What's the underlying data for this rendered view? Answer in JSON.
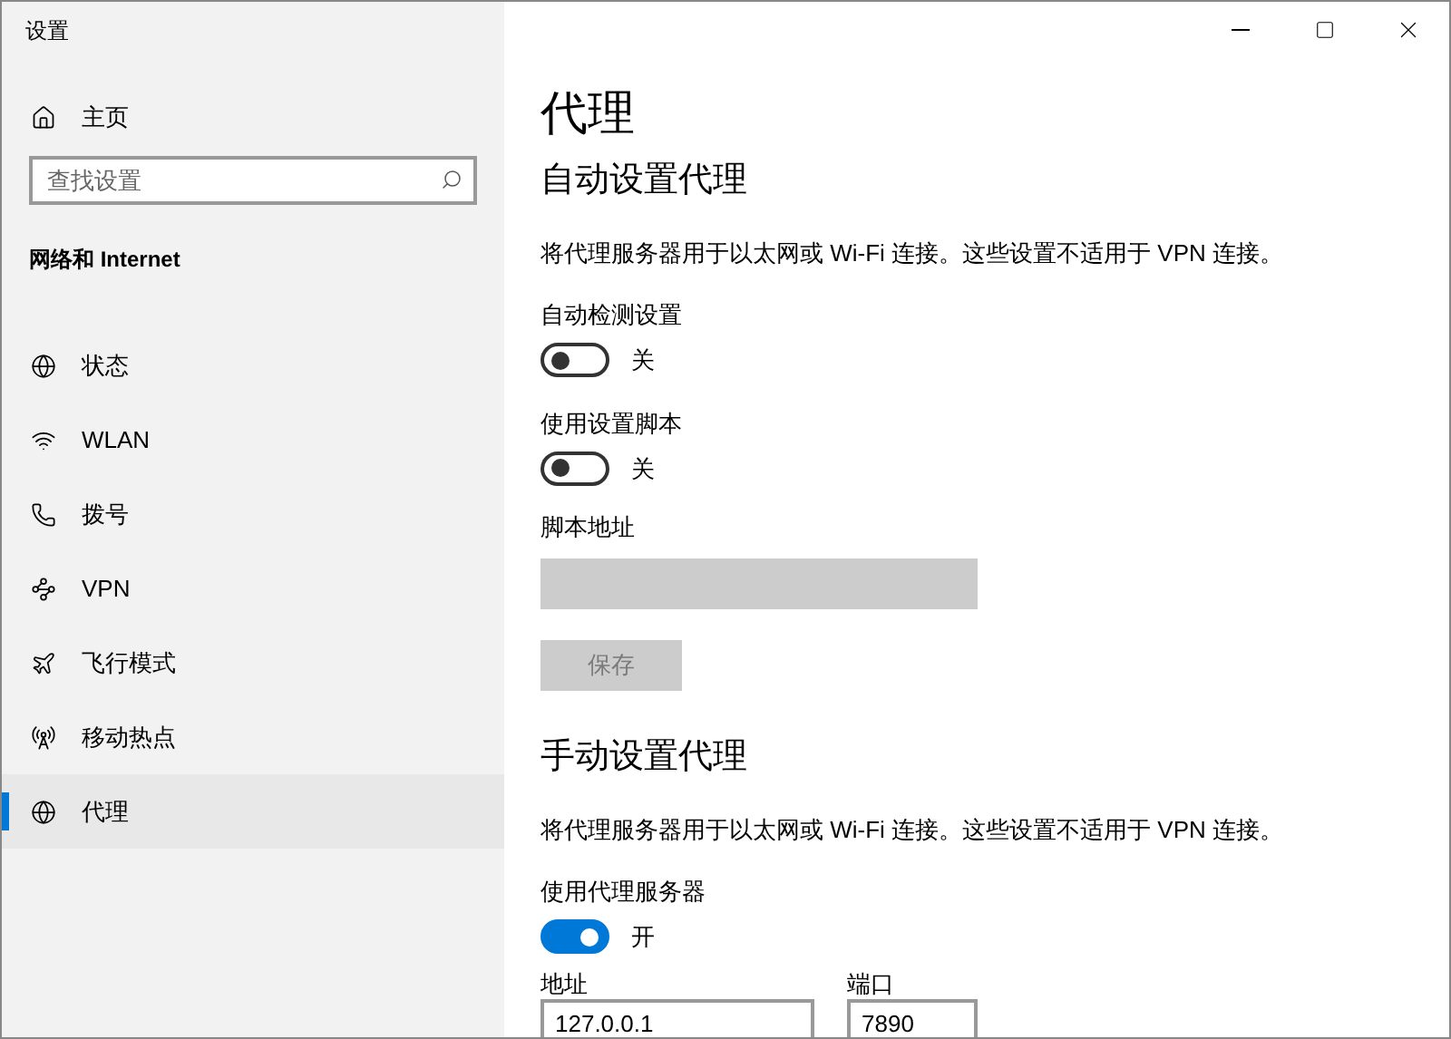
{
  "window": {
    "title": "设置"
  },
  "sidebar": {
    "home": {
      "label": "主页"
    },
    "search": {
      "placeholder": "查找设置"
    },
    "section_title": "网络和 Internet",
    "items": [
      {
        "label": "状态",
        "selected": false
      },
      {
        "label": "WLAN",
        "selected": false
      },
      {
        "label": "拨号",
        "selected": false
      },
      {
        "label": "VPN",
        "selected": false
      },
      {
        "label": "飞行模式",
        "selected": false
      },
      {
        "label": "移动热点",
        "selected": false
      },
      {
        "label": "代理",
        "selected": true
      }
    ]
  },
  "page": {
    "title": "代理",
    "sections": [
      {
        "heading": "自动设置代理",
        "description": "将代理服务器用于以太网或 Wi-Fi 连接。这些设置不适用于 VPN 连接。",
        "settings": [
          {
            "kind": "toggle",
            "label": "自动检测设置",
            "on": false,
            "state_text": "关"
          },
          {
            "kind": "toggle",
            "label": "使用设置脚本",
            "on": false,
            "state_text": "关"
          },
          {
            "kind": "field",
            "label": "脚本地址",
            "disabled": true
          },
          {
            "kind": "button",
            "label": "保存",
            "disabled": true
          }
        ]
      },
      {
        "heading": "手动设置代理",
        "description": "将代理服务器用于以太网或 Wi-Fi 连接。这些设置不适用于 VPN 连接。",
        "settings": [
          {
            "kind": "toggle",
            "label": "使用代理服务器",
            "on": true,
            "state_text": "开"
          },
          {
            "kind": "field_row",
            "fields": [
              {
                "label": "地址",
                "value": "127.0.0.1"
              },
              {
                "label": "端口",
                "value": "7890"
              }
            ]
          }
        ]
      }
    ]
  }
}
